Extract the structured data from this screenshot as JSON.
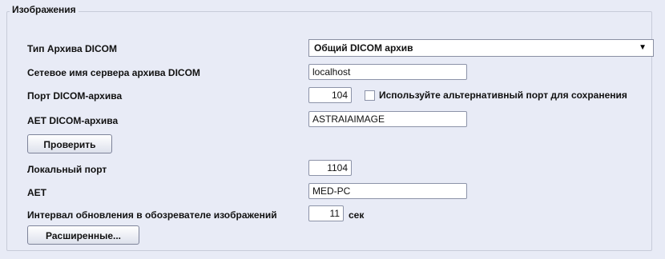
{
  "group": {
    "title": "Изображения"
  },
  "archive_type": {
    "label": "Тип Архива DICOM",
    "selected": "Общий DICOM архив",
    "arrow_icon": "▼"
  },
  "server_name": {
    "label": "Сетевое имя сервера архива DICOM",
    "value": "localhost"
  },
  "archive_port": {
    "label": "Порт DICOM-архива",
    "value": "104",
    "alt_port_checkbox_label": "Используйте альтернативный порт для сохранения",
    "alt_port_checked": false
  },
  "archive_aet": {
    "label": "AET DICOM-архива",
    "value": "ASTRAIAIMAGE"
  },
  "verify_button": {
    "label": "Проверить"
  },
  "local_port": {
    "label": "Локальный порт",
    "value": "1104"
  },
  "aet": {
    "label": "AET",
    "value": "MED-PC"
  },
  "refresh_interval": {
    "label": "Интервал обновления в обозревателе изображений",
    "value": "11",
    "unit": "сек"
  },
  "advanced_button": {
    "label": "Расширенные..."
  }
}
